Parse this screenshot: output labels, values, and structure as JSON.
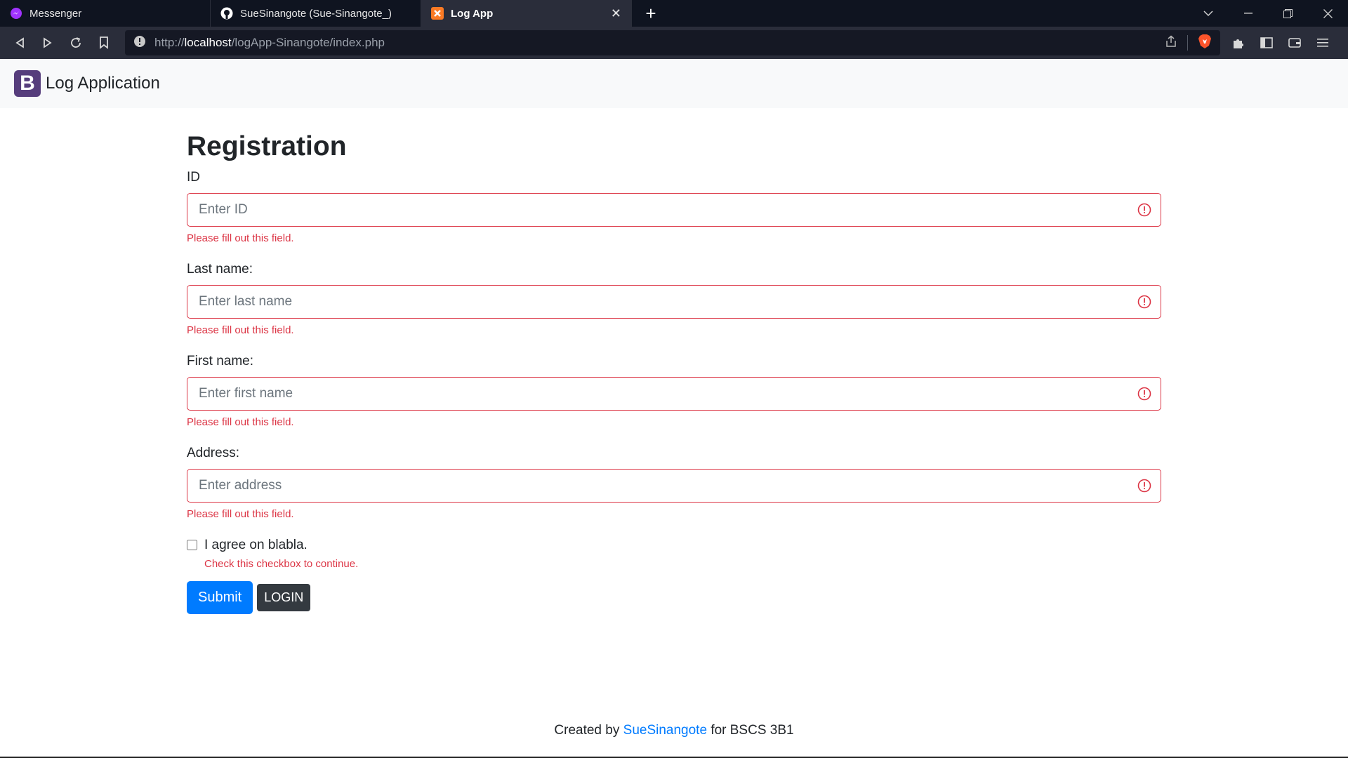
{
  "browser": {
    "tabs": [
      {
        "title": "Messenger",
        "icon": "messenger-icon",
        "active": false
      },
      {
        "title": "SueSinangote (Sue-Sinangote_)",
        "icon": "github-icon",
        "active": false
      },
      {
        "title": "Log App",
        "icon": "xampp-icon",
        "active": true
      }
    ],
    "url_prefix": "http://",
    "url_host": "localhost",
    "url_path": "/logApp-Sinangote/index.php"
  },
  "navbar": {
    "logo_letter": "B",
    "brand": "Log Application"
  },
  "form": {
    "heading": "Registration",
    "fields": [
      {
        "label": "ID",
        "placeholder": "Enter ID",
        "error": "Please fill out this field."
      },
      {
        "label": "Last name:",
        "placeholder": "Enter last name",
        "error": "Please fill out this field."
      },
      {
        "label": "First name:",
        "placeholder": "Enter first name",
        "error": "Please fill out this field."
      },
      {
        "label": "Address:",
        "placeholder": "Enter address",
        "error": "Please fill out this field."
      }
    ],
    "checkbox_label": "I agree on blabla.",
    "checkbox_error": "Check this checkbox to continue.",
    "submit_label": "Submit",
    "login_label": "LOGIN"
  },
  "footer": {
    "prefix": "Created by",
    "link": "SueSinangote",
    "suffix": "for BSCS 3B1"
  },
  "colors": {
    "primary": "#007bff",
    "danger": "#dc3545",
    "dark": "#343a40",
    "brand": "#563d7c"
  }
}
